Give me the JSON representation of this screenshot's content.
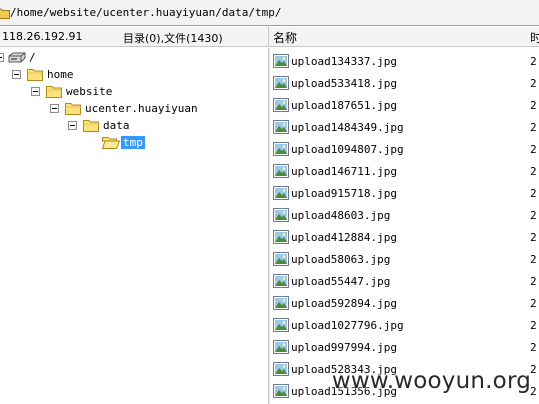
{
  "path_bar": {
    "path": "/home/website/ucenter.huayiyuan/data/tmp/"
  },
  "header": {
    "server_ip": "118.26.192.91",
    "counts": "目录(0),文件(1430)",
    "name_column": "名称",
    "date_column": "时"
  },
  "tree": {
    "root": "/",
    "home": "home",
    "website": "website",
    "ucenter": "ucenter.huayiyuan",
    "data": "data",
    "tmp": "tmp"
  },
  "files": [
    {
      "name": "upload134337.jpg",
      "date": "2"
    },
    {
      "name": "upload533418.jpg",
      "date": "2"
    },
    {
      "name": "upload187651.jpg",
      "date": "2"
    },
    {
      "name": "upload1484349.jpg",
      "date": "2"
    },
    {
      "name": "upload1094807.jpg",
      "date": "2"
    },
    {
      "name": "upload146711.jpg",
      "date": "2"
    },
    {
      "name": "upload915718.jpg",
      "date": "2"
    },
    {
      "name": "upload48603.jpg",
      "date": "2"
    },
    {
      "name": "upload412884.jpg",
      "date": "2"
    },
    {
      "name": "upload58063.jpg",
      "date": "2"
    },
    {
      "name": "upload55447.jpg",
      "date": "2"
    },
    {
      "name": "upload592894.jpg",
      "date": "2"
    },
    {
      "name": "upload1027796.jpg",
      "date": "2"
    },
    {
      "name": "upload997994.jpg",
      "date": "2"
    },
    {
      "name": "upload528343.jpg",
      "date": "2"
    },
    {
      "name": "upload151356.jpg",
      "date": "2"
    }
  ],
  "watermark": "www.wooyun.org",
  "icons": {
    "folder": "folder-icon",
    "drive": "drive-icon",
    "image_file": "image-file-icon",
    "collapse": "collapse-toggle-icon"
  },
  "colors": {
    "folder_fill": "#fce27a",
    "selection": "#3399ff",
    "header_bg": "#f4f4f4"
  }
}
